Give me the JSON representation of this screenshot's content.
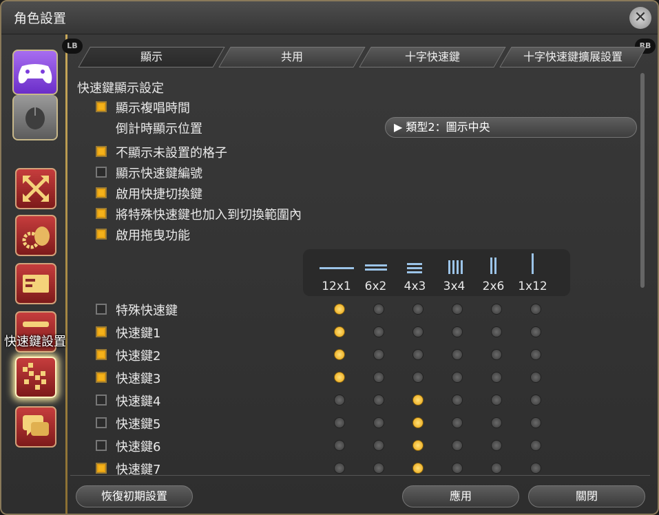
{
  "window": {
    "title": "角色設置"
  },
  "tabs": {
    "lb": "LB",
    "rb": "RB",
    "items": [
      {
        "label": "顯示"
      },
      {
        "label": "共用"
      },
      {
        "label": "十字快速鍵"
      },
      {
        "label": "十字快速鍵擴展設置"
      }
    ]
  },
  "sidebar": {
    "tooltip": "快速鍵設置"
  },
  "section": {
    "title": "快速鍵顯示設定"
  },
  "options": [
    {
      "label": "顯示複唱時間",
      "checked": true
    },
    {
      "label": "倒計時顯示位置",
      "checked": null
    },
    {
      "label": "不顯示未設置的格子",
      "checked": true
    },
    {
      "label": "顯示快速鍵編號",
      "checked": false
    },
    {
      "label": "啟用快捷切換鍵",
      "checked": true
    },
    {
      "label": "將特殊快速鍵也加入到切換範圍內",
      "checked": true
    },
    {
      "label": "啟用拖曳功能",
      "checked": true
    }
  ],
  "countdown_dropdown": {
    "value": "▶ 類型2：圖示中央"
  },
  "layouts": [
    "12x1",
    "6x2",
    "4x3",
    "3x4",
    "2x6",
    "1x12"
  ],
  "hotbars": [
    {
      "label": "特殊快速鍵",
      "checked": false,
      "layout": 0
    },
    {
      "label": "快速鍵1",
      "checked": true,
      "layout": 0
    },
    {
      "label": "快速鍵2",
      "checked": true,
      "layout": 0
    },
    {
      "label": "快速鍵3",
      "checked": true,
      "layout": 0
    },
    {
      "label": "快速鍵4",
      "checked": false,
      "layout": 2
    },
    {
      "label": "快速鍵5",
      "checked": false,
      "layout": 2
    },
    {
      "label": "快速鍵6",
      "checked": false,
      "layout": 2
    },
    {
      "label": "快速鍵7",
      "checked": true,
      "layout": 2
    }
  ],
  "footer": {
    "reset": "恢復初期設置",
    "apply": "應用",
    "close": "關閉"
  }
}
